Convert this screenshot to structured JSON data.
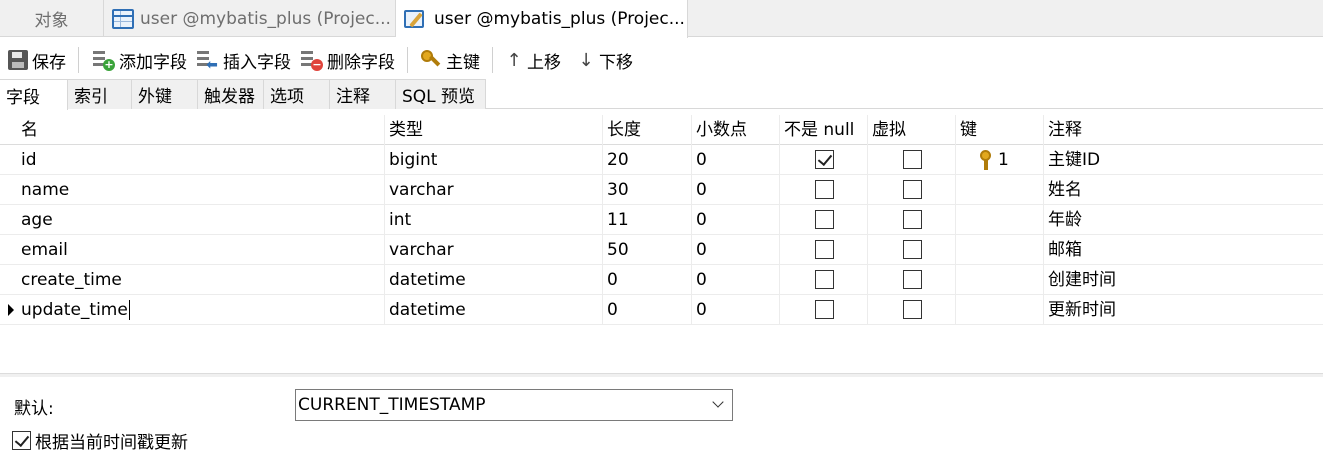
{
  "doc_tabs": [
    {
      "label": "对象"
    },
    {
      "label": "user @mybatis_plus (Projec..."
    },
    {
      "label": "user @mybatis_plus (Projec..."
    }
  ],
  "toolbar": {
    "save": "保存",
    "add_field": "添加字段",
    "insert_field": "插入字段",
    "delete_field": "删除字段",
    "primary_key": "主键",
    "move_up": "上移",
    "move_down": "下移"
  },
  "sub_tabs": [
    "字段",
    "索引",
    "外键",
    "触发器",
    "选项",
    "注释",
    "SQL 预览"
  ],
  "columns": [
    "名",
    "类型",
    "长度",
    "小数点",
    "不是 null",
    "虚拟",
    "键",
    "注释"
  ],
  "rows": [
    {
      "name": "id",
      "type": "bigint",
      "length": "20",
      "decimals": "0",
      "not_null": true,
      "virtual": false,
      "key": "1",
      "comment": "主键ID"
    },
    {
      "name": "name",
      "type": "varchar",
      "length": "30",
      "decimals": "0",
      "not_null": false,
      "virtual": false,
      "key": "",
      "comment": "姓名"
    },
    {
      "name": "age",
      "type": "int",
      "length": "11",
      "decimals": "0",
      "not_null": false,
      "virtual": false,
      "key": "",
      "comment": "年龄"
    },
    {
      "name": "email",
      "type": "varchar",
      "length": "50",
      "decimals": "0",
      "not_null": false,
      "virtual": false,
      "key": "",
      "comment": "邮箱"
    },
    {
      "name": "create_time",
      "type": "datetime",
      "length": "0",
      "decimals": "0",
      "not_null": false,
      "virtual": false,
      "key": "",
      "comment": "创建时间"
    },
    {
      "name": "update_time",
      "type": "datetime",
      "length": "0",
      "decimals": "0",
      "not_null": false,
      "virtual": false,
      "key": "",
      "comment": "更新时间"
    }
  ],
  "properties": {
    "default_label": "默认:",
    "default_value": "CURRENT_TIMESTAMP",
    "update_on_timestamp_label": "根据当前时间戳更新",
    "update_on_timestamp_checked": true
  }
}
